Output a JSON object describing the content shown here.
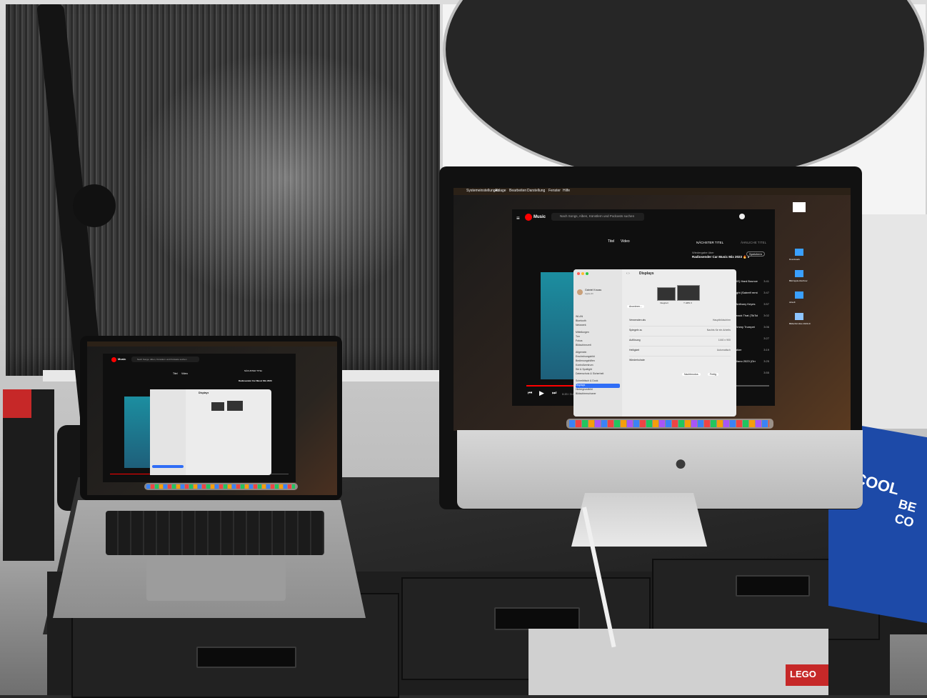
{
  "imac": {
    "menu": [
      "Systemeinstellungen",
      "Ablage",
      "Bearbeiten",
      "Darstellung",
      "Fenster",
      "Hilfe"
    ],
    "ytm": {
      "logo": "Music",
      "search_placeholder": "Nach Songs, Alben, Künstlern und Podcasts suchen",
      "tabs": [
        "Titel",
        "Video"
      ],
      "queue_header": "NÄCHSTER TITEL",
      "queue_header_right": "ÄHNLICHE TITEL",
      "playlist_label": "Wiedergabe über",
      "playlist_title": "Radiosender Car Music Mix 2023 🔥 Ba",
      "save_label": "Speichern",
      "queue_items": [
        {
          "title": "Rock (VIE) Hard Bounce",
          "time": "3:41"
        },
        {
          "title": "come night (Sabrelf remix)",
          "time": "3:47"
        },
        {
          "title": "Remix) Anthony Keyes",
          "time": "3:57"
        },
        {
          "title": "nne - Smack That (TikTok",
          "time": "3:02"
        },
        {
          "title": "ft. and Timmy Trumpet",
          "time": "3:06"
        },
        {
          "title": "Spectre",
          "time": "3:27"
        },
        {
          "title": "Alan Walker",
          "time": "3:19"
        },
        {
          "title": "ndite Italiano 2023 (Orr",
          "time": "3:25"
        },
        {
          "title": "",
          "time": "3:55"
        }
      ],
      "player_time": "0:20 / 3:44"
    },
    "settings": {
      "window_title": "Displays",
      "user_name": "Gabriel Krauss",
      "user_sub": "Apple-ID",
      "sidebar": [
        "WLAN",
        "Bluetooth",
        "Netzwerk",
        "Mitteilungen",
        "Ton",
        "Fokus",
        "Bildschirmzeit",
        "Allgemein",
        "Erscheinungsbild",
        "Bedienungshilfen",
        "Kontrollzentrum",
        "Siri & Spotlight",
        "Datenschutz & Sicherheit",
        "Schreibtisch & Dock",
        "Displays",
        "Hintergrundbild",
        "Bildschirmschoner"
      ],
      "selected": "Displays",
      "display_labels": [
        "Integriert",
        "Y HRS 3"
      ],
      "arrange_button": "Anordnen...",
      "rows": [
        {
          "label": "Verwenden als",
          "value": "Hauptbildschirm"
        },
        {
          "label": "Spiegeln zu",
          "value": "Nachts für ein Arbeits"
        },
        {
          "label": "Auflösung",
          "value": "1440 x 900"
        },
        {
          "label": "Helligkeit",
          "value": "Automatisch"
        },
        {
          "label": "Wiederholrate",
          "value": ""
        }
      ],
      "bottom_buttons": [
        "Nachtmodus",
        "Fertig"
      ]
    },
    "desktop_icons": [
      "Downloads",
      "Bild Apple-Rechner",
      "Airsoft",
      "Bildschirmfoto 2023-07...png"
    ]
  },
  "macbook": {
    "ytm": {
      "logo": "Music",
      "search_placeholder": "Nach Songs, Alben, Künstlern und Podcasts suchen",
      "queue_header": "NÄCHSTER TITEL",
      "playlist_title": "Radiosender Car Music Mix 2023",
      "tabs": [
        "Titel",
        "Video"
      ]
    },
    "settings": {
      "window_title": "Displays"
    }
  },
  "environment": {
    "box_label": "BE COOL",
    "box_label_2": "BE CO",
    "lego_label": "LEGO"
  }
}
